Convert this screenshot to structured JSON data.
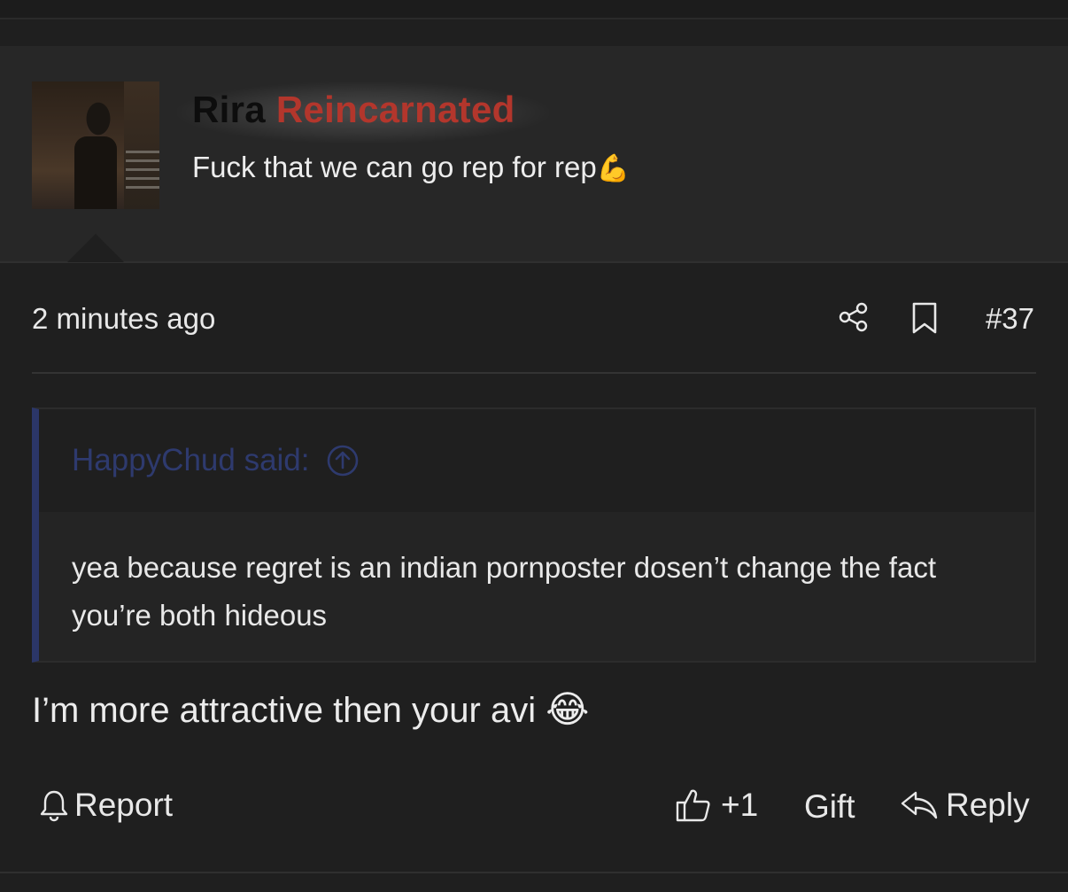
{
  "post": {
    "author": {
      "name_part1": "Rira",
      "name_part2": "Reincarnated",
      "name_colors": [
        "#0d0d0d",
        "#b3362c"
      ],
      "status": "Fuck that we can go rep for rep",
      "status_emoji": "💪"
    },
    "time": "2 minutes ago",
    "number": "#37",
    "quote": {
      "author": "HappyChud said:",
      "text": "yea because regret is an indian pornposter dosen’t change the fact you’re both hideous"
    },
    "message": "I’m more attractive then your avi",
    "message_emoji": "😂",
    "actions": {
      "report": "Report",
      "like": "+1",
      "gift": "Gift",
      "reply": "Reply"
    }
  },
  "icons": {
    "share": "share-icon",
    "bookmark": "bookmark-icon",
    "up": "arrow-up-circle-icon",
    "bell": "bell-icon",
    "thumb": "thumbs-up-icon",
    "reply": "reply-icon"
  },
  "colors": {
    "background": "#1f1f1f",
    "header_bg": "#272727",
    "quote_accent": "#2b3668",
    "quote_author": "#2e3a6e"
  }
}
